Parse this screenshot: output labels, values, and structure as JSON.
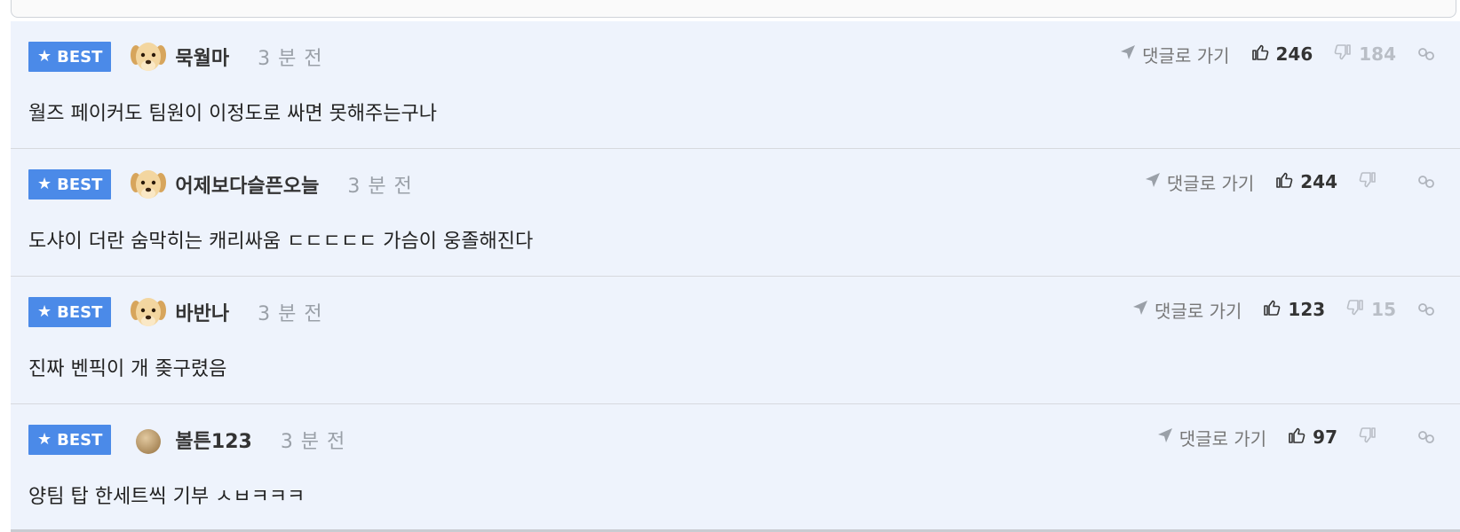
{
  "comments": [
    {
      "badge": "BEST",
      "avatar": "dog-avatar",
      "username": "묵월마",
      "time": "3 분 전",
      "goto": "댓글로 가기",
      "likes": "246",
      "dislikes": "184",
      "text": "월즈 페이커도 팀원이 이정도로 싸면 못해주는구나"
    },
    {
      "badge": "BEST",
      "avatar": "dog-avatar",
      "username": "어제보다슬픈오늘",
      "time": "3 분 전",
      "goto": "댓글로 가기",
      "likes": "244",
      "dislikes": "",
      "text": "도샤이 더란 숨막히는 캐리싸움 ㄷㄷㄷㄷㄷ 가슴이 웅졸해진다"
    },
    {
      "badge": "BEST",
      "avatar": "dog-avatar",
      "username": "바반나",
      "time": "3 분 전",
      "goto": "댓글로 가기",
      "likes": "123",
      "dislikes": "15",
      "text": "진짜 벤픽이 개 좆구렸음"
    },
    {
      "badge": "BEST",
      "avatar": "circle-avatar",
      "username": "볼튼123",
      "time": "3 분 전",
      "goto": "댓글로 가기",
      "likes": "97",
      "dislikes": "",
      "text": "양팀 탑 한세트씩 기부 ㅅㅂㅋㅋㅋ"
    }
  ],
  "colors": {
    "badge_bg": "#4b8ae8",
    "row_bg": "#eef3fc",
    "muted": "#9aa0a8"
  }
}
